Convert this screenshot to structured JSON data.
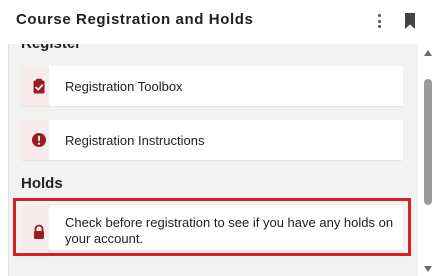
{
  "header": {
    "title": "Course Registration and Holds",
    "menu_icon": "more-vertical-icon",
    "bookmark_icon": "bookmark-icon"
  },
  "sections": {
    "register_heading_partial": "Register",
    "holds_heading": "Holds"
  },
  "cards": [
    {
      "label": "Registration Toolbox",
      "icon": "clipboard-check-icon"
    },
    {
      "label": "Registration Instructions",
      "icon": "info-icon"
    },
    {
      "label": "Check before registration to see if you have any holds on your account.",
      "icon": "lock-icon",
      "highlighted": true
    }
  ],
  "colors": {
    "accent": "#9b1b1f",
    "highlight_border": "#d61f26",
    "panel_bg": "#f2f2f2"
  }
}
